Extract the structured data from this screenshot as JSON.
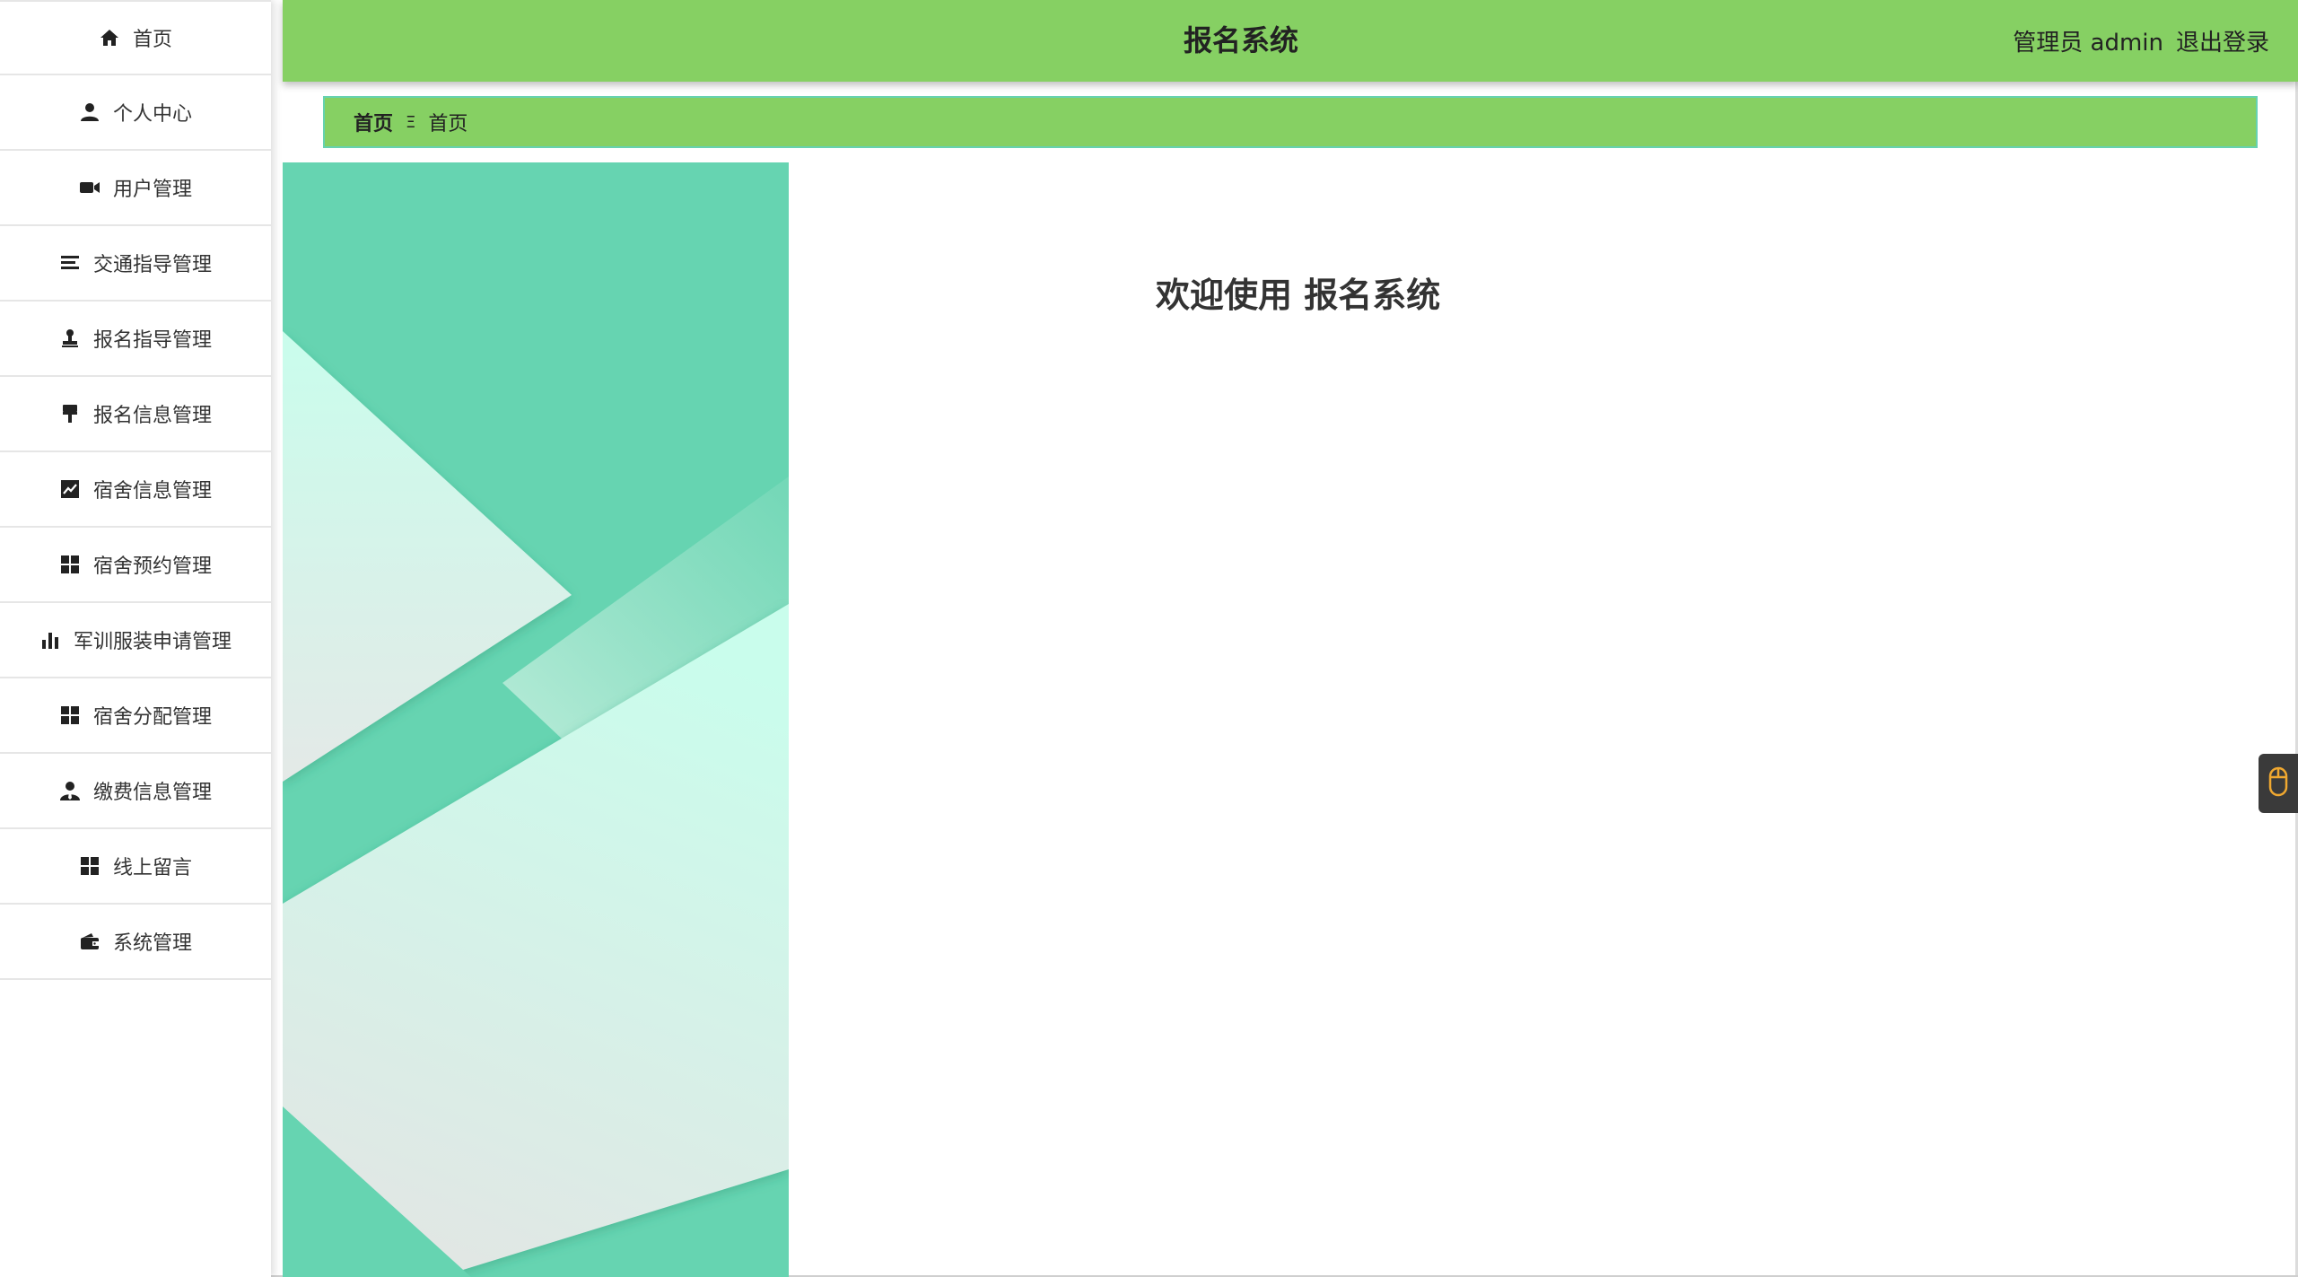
{
  "sidebar": {
    "items": [
      {
        "label": "首页",
        "icon": "home-icon"
      },
      {
        "label": "个人中心",
        "icon": "user-icon"
      },
      {
        "label": "用户管理",
        "icon": "video-camera-icon"
      },
      {
        "label": "交通指导管理",
        "icon": "list-icon"
      },
      {
        "label": "报名指导管理",
        "icon": "stamp-icon"
      },
      {
        "label": "报名信息管理",
        "icon": "paint-roller-icon"
      },
      {
        "label": "宿舍信息管理",
        "icon": "line-chart-icon"
      },
      {
        "label": "宿舍预约管理",
        "icon": "grid-icon"
      },
      {
        "label": "军训服装申请管理",
        "icon": "bar-chart-icon"
      },
      {
        "label": "宿舍分配管理",
        "icon": "grid-icon"
      },
      {
        "label": "缴费信息管理",
        "icon": "user-tie-icon"
      },
      {
        "label": "线上留言",
        "icon": "grid-icon"
      },
      {
        "label": "系统管理",
        "icon": "wallet-icon"
      }
    ]
  },
  "header": {
    "title": "报名系统",
    "user": "管理员 admin",
    "logout": "退出登录"
  },
  "breadcrumb": {
    "home": "首页",
    "separator": "Ξ",
    "current": "首页"
  },
  "main": {
    "welcome": "欢迎使用 报名系统"
  },
  "colors": {
    "header": "#86d063",
    "breadcrumb": "#86d063",
    "breadcrumb_border": "#66d2b0",
    "deco_bg": "#66d4b1",
    "deco_light": "#ccfdee",
    "deco_pale": "#e3e8e6"
  }
}
